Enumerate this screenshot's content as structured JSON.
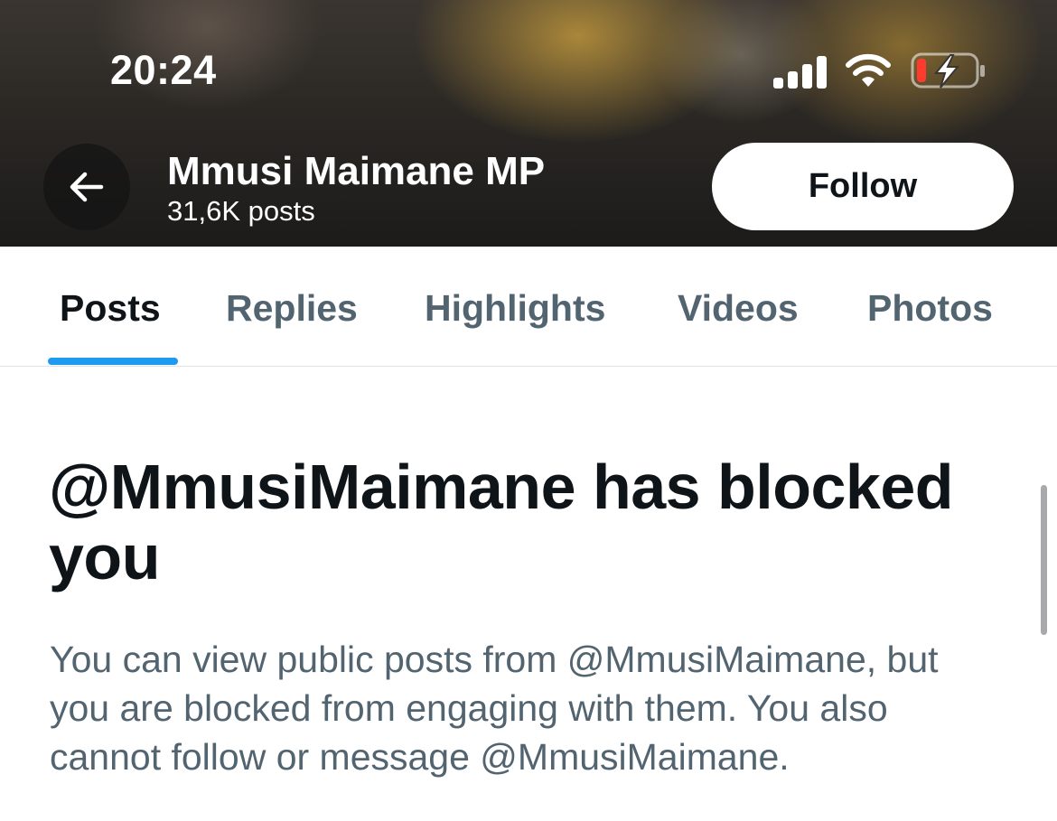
{
  "status_bar": {
    "time": "20:24",
    "signal_icon": "cellular-signal-icon",
    "wifi_icon": "wifi-icon",
    "battery_icon": "battery-charging-icon",
    "battery_level_fraction": 0.15,
    "battery_low_color": "#ff3b30"
  },
  "header": {
    "back_icon": "arrow-left-icon",
    "name": "Mmusi Maimane MP",
    "post_count": "31,6K posts",
    "follow_label": "Follow"
  },
  "tabs": [
    {
      "label": "Posts",
      "active": true
    },
    {
      "label": "Replies",
      "active": false
    },
    {
      "label": "Highlights",
      "active": false
    },
    {
      "label": "Videos",
      "active": false
    },
    {
      "label": "Photos",
      "active": false
    }
  ],
  "notice": {
    "title": "@MmusiMaimane has blocked you",
    "description": "You can view public posts from @MmusiMaimane, but you are blocked from engaging with them. You also cannot follow or message @MmusiMaimane."
  },
  "colors": {
    "accent": "#1d9bf0",
    "text_primary": "#0f1419",
    "text_secondary": "#536471"
  }
}
